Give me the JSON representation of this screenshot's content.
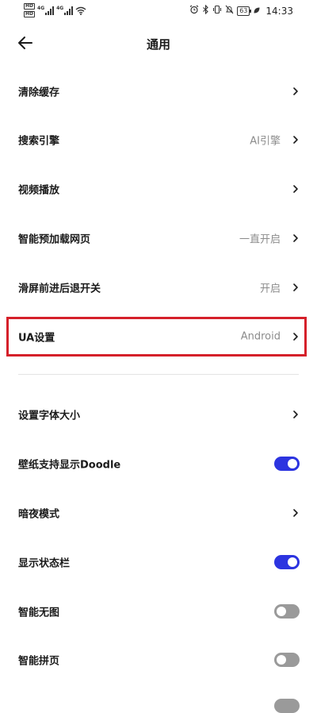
{
  "status_bar": {
    "hd_top": "HD",
    "hd_bottom": "HD",
    "gen1": "4G",
    "gen2": "4G",
    "battery": "63",
    "time": "14:33"
  },
  "header": {
    "title": "通用"
  },
  "settings": [
    {
      "label": "清除缓存",
      "value": ""
    },
    {
      "label": "搜索引擎",
      "value": "AI引擎"
    },
    {
      "label": "视频播放",
      "value": ""
    },
    {
      "label": "智能预加载网页",
      "value": "一直开启"
    },
    {
      "label": "滑屏前进后退开关",
      "value": "开启"
    },
    {
      "label": "UA设置",
      "value": "Android"
    }
  ],
  "settings2": [
    {
      "label": "设置字体大小",
      "control": "chevron"
    },
    {
      "label": "壁纸支持显示Doodle",
      "control": "toggle",
      "on": true
    },
    {
      "label": "暗夜模式",
      "control": "chevron"
    },
    {
      "label": "显示状态栏",
      "control": "toggle",
      "on": true
    },
    {
      "label": "智能无图",
      "control": "toggle",
      "on": false
    },
    {
      "label": "智能拼页",
      "control": "toggle",
      "on": false
    }
  ],
  "colors": {
    "toggle_on": "#2c34e0",
    "toggle_off": "#9a9a9a",
    "highlight": "#d5202a"
  }
}
